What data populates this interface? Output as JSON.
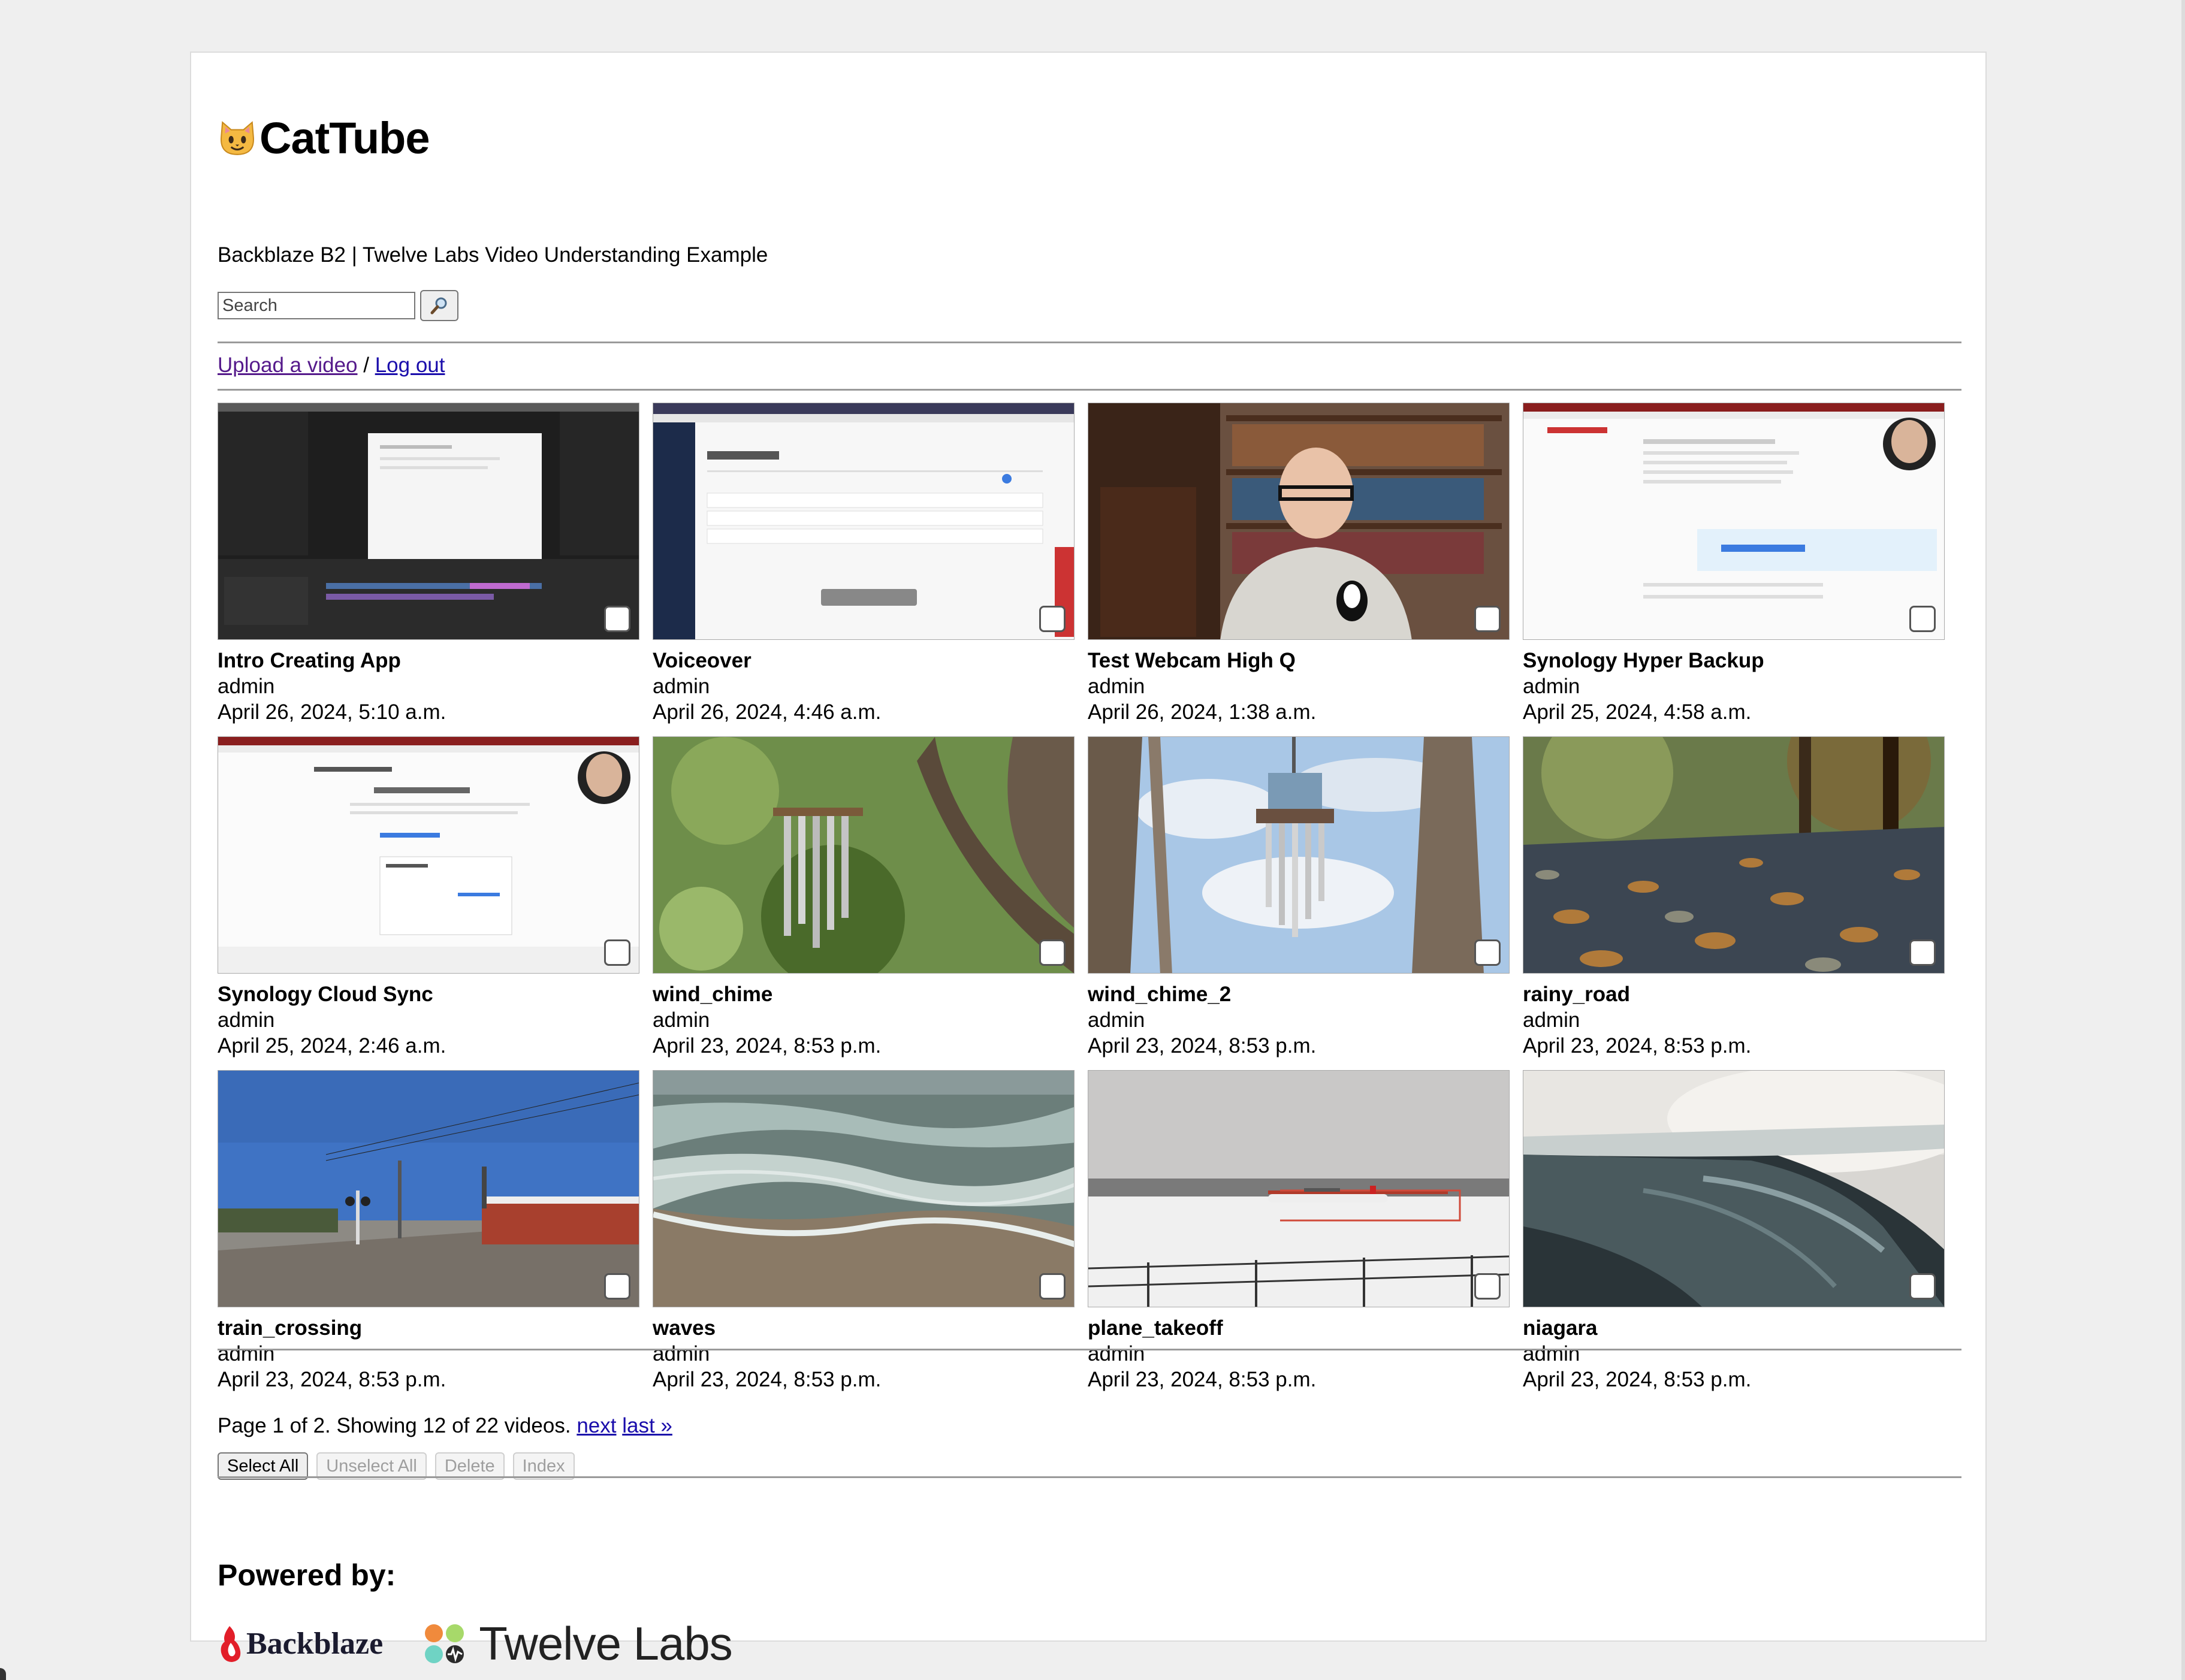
{
  "header": {
    "title": "CatTube",
    "subtitle": "Backblaze B2 | Twelve Labs Video Understanding Example"
  },
  "search": {
    "placeholder": "Search",
    "button_icon": "magnifier-icon"
  },
  "nav": {
    "upload_label": "Upload a video",
    "separator": "/",
    "logout_label": "Log out"
  },
  "videos": [
    {
      "title": "Intro Creating App",
      "owner": "admin",
      "date": "April 26, 2024, 5:10 a.m."
    },
    {
      "title": "Voiceover",
      "owner": "admin",
      "date": "April 26, 2024, 4:46 a.m."
    },
    {
      "title": "Test Webcam High Q",
      "owner": "admin",
      "date": "April 26, 2024, 1:38 a.m."
    },
    {
      "title": "Synology Hyper Backup",
      "owner": "admin",
      "date": "April 25, 2024, 4:58 a.m."
    },
    {
      "title": "Synology Cloud Sync",
      "owner": "admin",
      "date": "April 25, 2024, 2:46 a.m."
    },
    {
      "title": "wind_chime",
      "owner": "admin",
      "date": "April 23, 2024, 8:53 p.m."
    },
    {
      "title": "wind_chime_2",
      "owner": "admin",
      "date": "April 23, 2024, 8:53 p.m."
    },
    {
      "title": "rainy_road",
      "owner": "admin",
      "date": "April 23, 2024, 8:53 p.m."
    },
    {
      "title": "train_crossing",
      "owner": "admin",
      "date": "April 23, 2024, 8:53 p.m."
    },
    {
      "title": "waves",
      "owner": "admin",
      "date": "April 23, 2024, 8:53 p.m."
    },
    {
      "title": "plane_takeoff",
      "owner": "admin",
      "date": "April 23, 2024, 8:53 p.m."
    },
    {
      "title": "niagara",
      "owner": "admin",
      "date": "April 23, 2024, 8:53 p.m."
    }
  ],
  "pagination": {
    "summary": "Page 1 of 2. Showing 12 of 22 videos.",
    "next_label": "next",
    "last_label": "last »"
  },
  "actions": {
    "select_all": "Select All",
    "unselect_all": "Unselect All",
    "delete": "Delete",
    "index": "Index"
  },
  "footer": {
    "powered_by": "Powered by:",
    "backblaze": "Backblaze",
    "twelve_labs": "Twelve Labs"
  },
  "colors": {
    "link": "#1a0dab",
    "visited": "#551a8b",
    "backblaze_red": "#e21e29"
  }
}
